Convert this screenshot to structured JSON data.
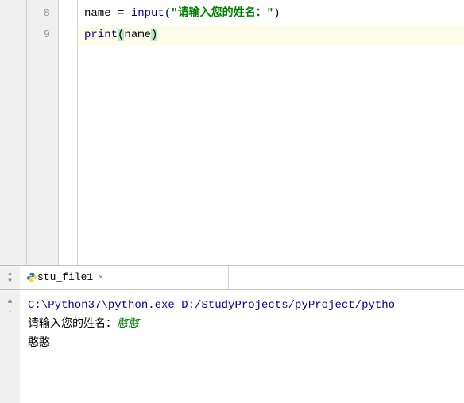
{
  "editor": {
    "lines": [
      {
        "number": "8",
        "highlighted": false,
        "tokens": {
          "var1": "name",
          "op1": " = ",
          "builtin1": "input",
          "paren_open1": "(",
          "string1": "\"请输入您的姓名：\"",
          "paren_close1": ")"
        }
      },
      {
        "number": "9",
        "highlighted": true,
        "tokens": {
          "builtin2": "print",
          "paren_open2": "(",
          "var2": "name",
          "paren_close2": ")"
        }
      }
    ]
  },
  "tab": {
    "filename": "stu_file1",
    "close": "×"
  },
  "console": {
    "command_path": "C:\\Python37\\python.exe D:/StudyProjects/pyProject/pytho",
    "prompt": "请输入您的姓名：",
    "user_input": "憨憨",
    "output": "憨憨"
  }
}
